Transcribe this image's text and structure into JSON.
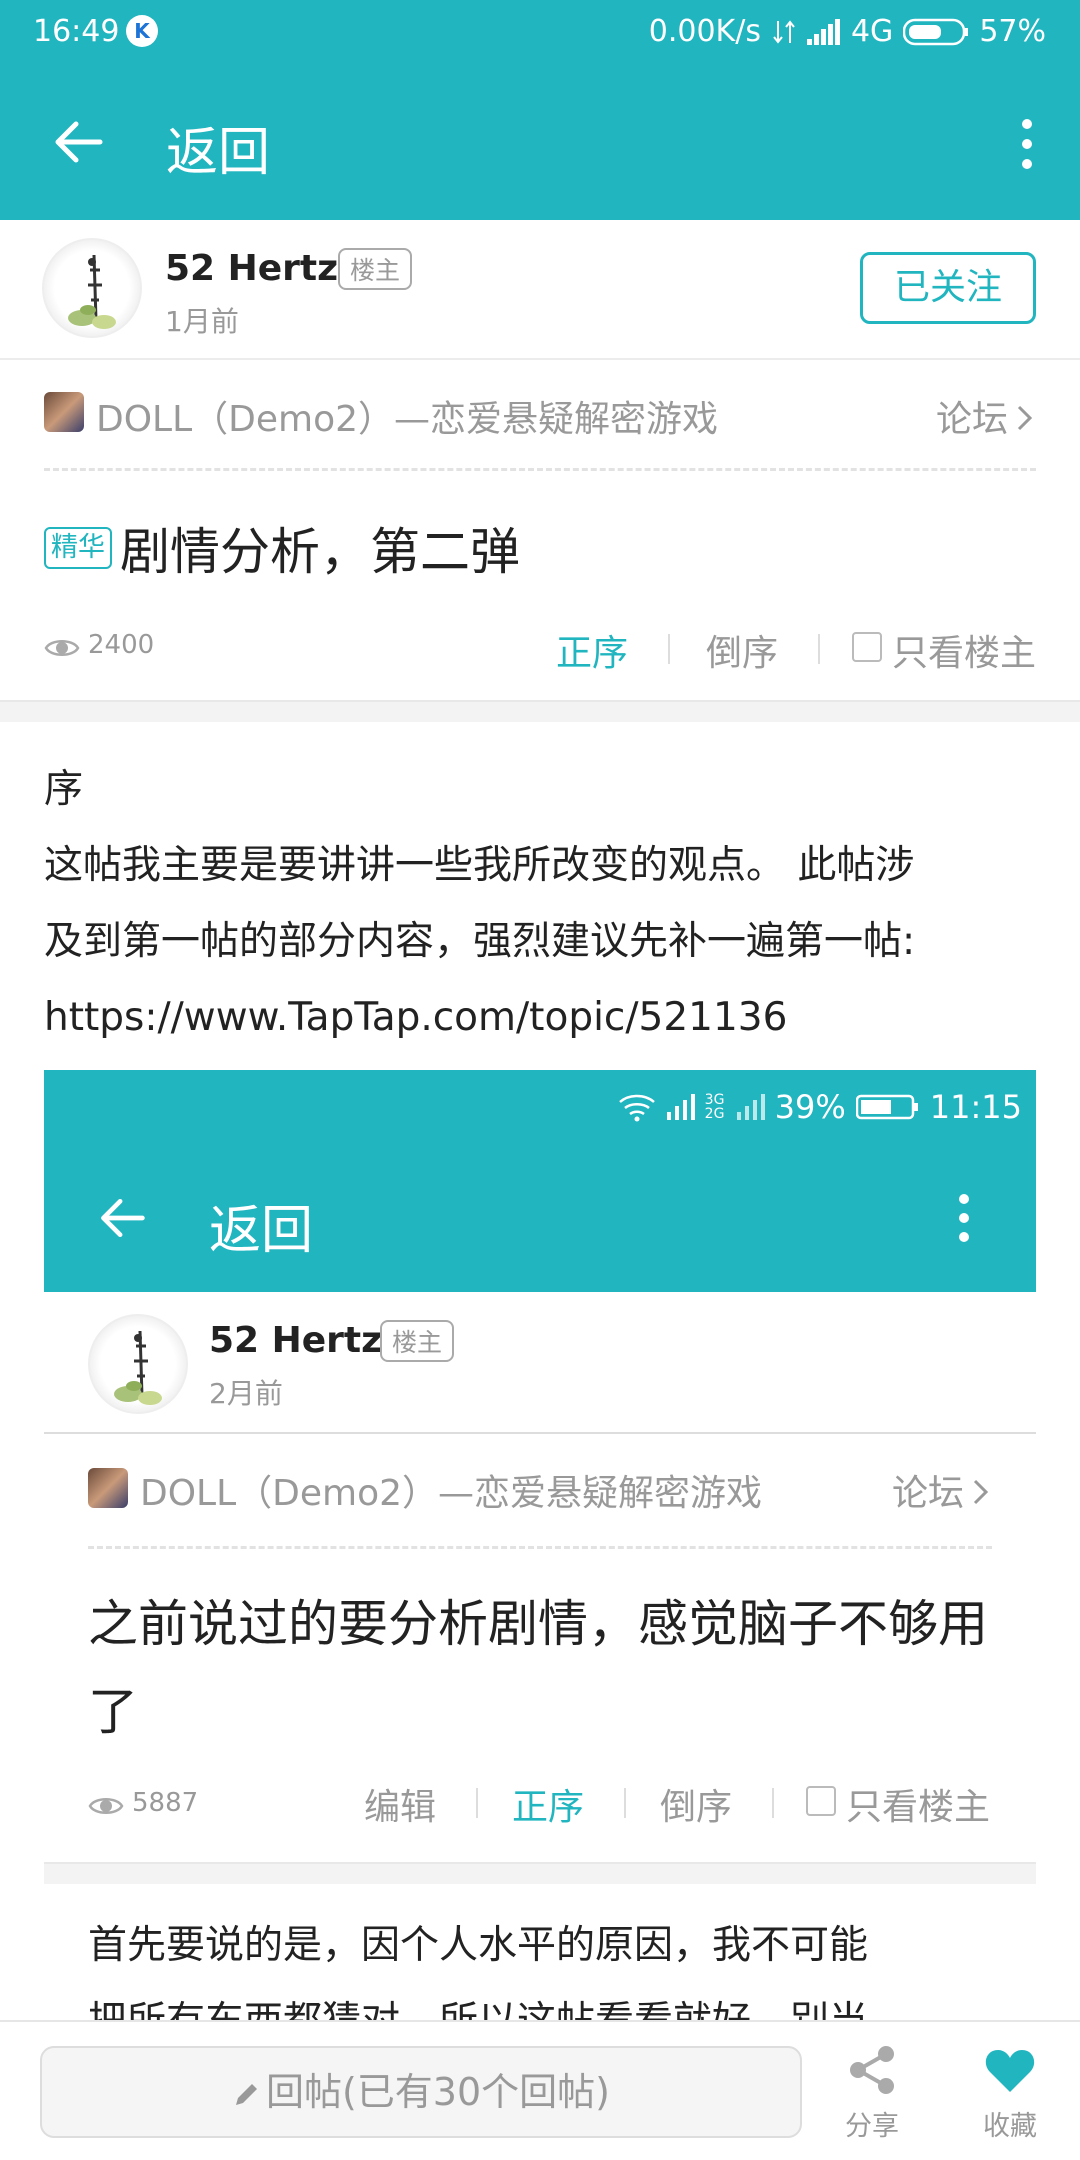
{
  "status_bar": {
    "time": "16:49",
    "k_icon": "K",
    "speed": "0.00K/s",
    "network": "4G",
    "battery": "57%"
  },
  "app_bar": {
    "title": "返回"
  },
  "author": {
    "name": "52 Hertz",
    "badge": "楼主",
    "time": "1月前",
    "follow_label": "已关注"
  },
  "forum": {
    "name": "DOLL（Demo2）—恋爱悬疑解密游戏",
    "link": "论坛"
  },
  "post": {
    "tag": "精华",
    "title": "剧情分析，第二弹",
    "views": "2400"
  },
  "sort": {
    "asc": "正序",
    "desc": "倒序",
    "only_op": "只看楼主"
  },
  "content": {
    "lines": [
      "序",
      "这帖我主要是要讲讲一些我所改变的观点。 此帖涉",
      "及到第一帖的部分内容，强烈建议先补一遍第一帖:",
      "https://www.TapTap.com/topic/521136"
    ]
  },
  "embedded": {
    "status": {
      "network": "3G 2G",
      "battery": "39%",
      "time": "11:15"
    },
    "app_bar_title": "返回",
    "author_name": "52 Hertz",
    "badge": "楼主",
    "time": "2月前",
    "forum_name": "DOLL（Demo2）—恋爱悬疑解密游戏",
    "forum_link": "论坛",
    "title": "之前说过的要分析剧情，感觉脑子不够用了",
    "views": "5887",
    "edit": "编辑",
    "asc": "正序",
    "desc": "倒序",
    "only_op": "只看楼主",
    "body_lines": [
      "首先要说的是，因个人水平的原因，我不可能",
      "把所有东西都猜对，所以这帖看看就好，别当"
    ]
  },
  "bottom_bar": {
    "reply_placeholder": "回帖(已有30个回帖)",
    "share": "分享",
    "collect": "收藏"
  },
  "colors": {
    "accent": "#21b5c0",
    "text": "#222222",
    "muted": "#999999"
  }
}
